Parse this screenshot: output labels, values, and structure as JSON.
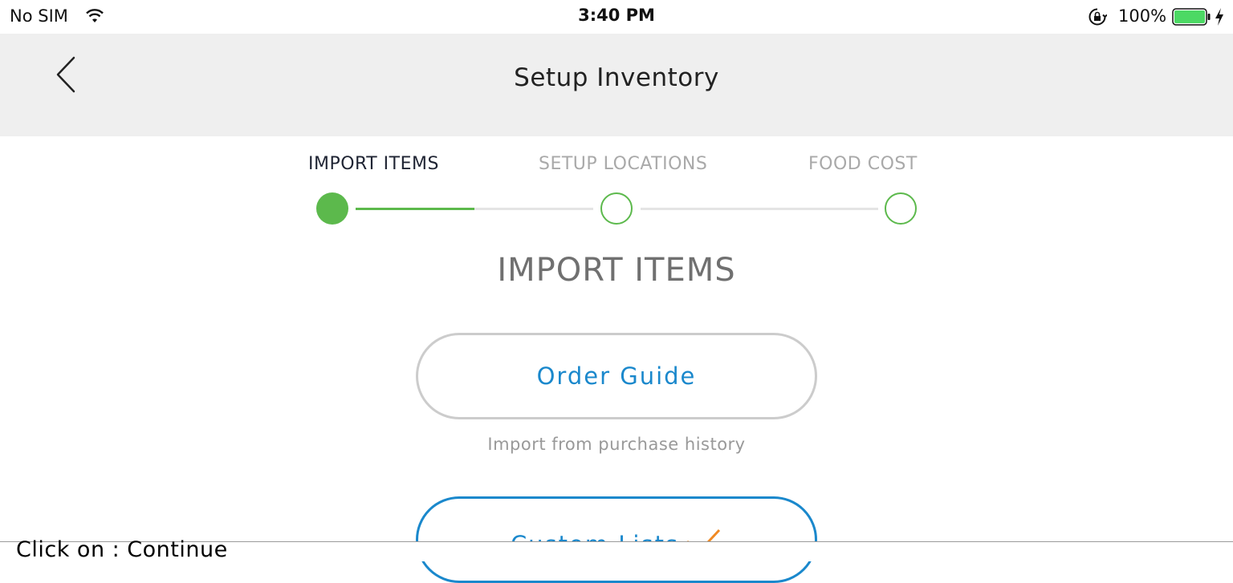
{
  "status_bar": {
    "carrier": "No SIM",
    "time": "3:40 PM",
    "battery_percent": "100%",
    "battery_level": 1.0,
    "icons": [
      "wifi-icon",
      "orientation-lock-icon",
      "battery-icon",
      "charging-bolt-icon"
    ]
  },
  "nav": {
    "title": "Setup Inventory",
    "back_icon": "chevron-left-icon"
  },
  "stepper": {
    "steps": [
      {
        "label": "IMPORT ITEMS",
        "state": "active"
      },
      {
        "label": "SETUP LOCATIONS",
        "state": "inactive"
      },
      {
        "label": "FOOD COST",
        "state": "inactive"
      }
    ],
    "progress_first_segment": 0.5,
    "accent_color": "#5cb94c"
  },
  "main": {
    "heading": "IMPORT ITEMS",
    "order_guide": {
      "label": "Order Guide",
      "caption": "Import from purchase history"
    },
    "custom_lists": {
      "label": "Custom Lists",
      "selected_icon": "checkmark-icon"
    },
    "link_color": "#1a88cc"
  },
  "instruction": {
    "text": "Click on : Continue"
  }
}
